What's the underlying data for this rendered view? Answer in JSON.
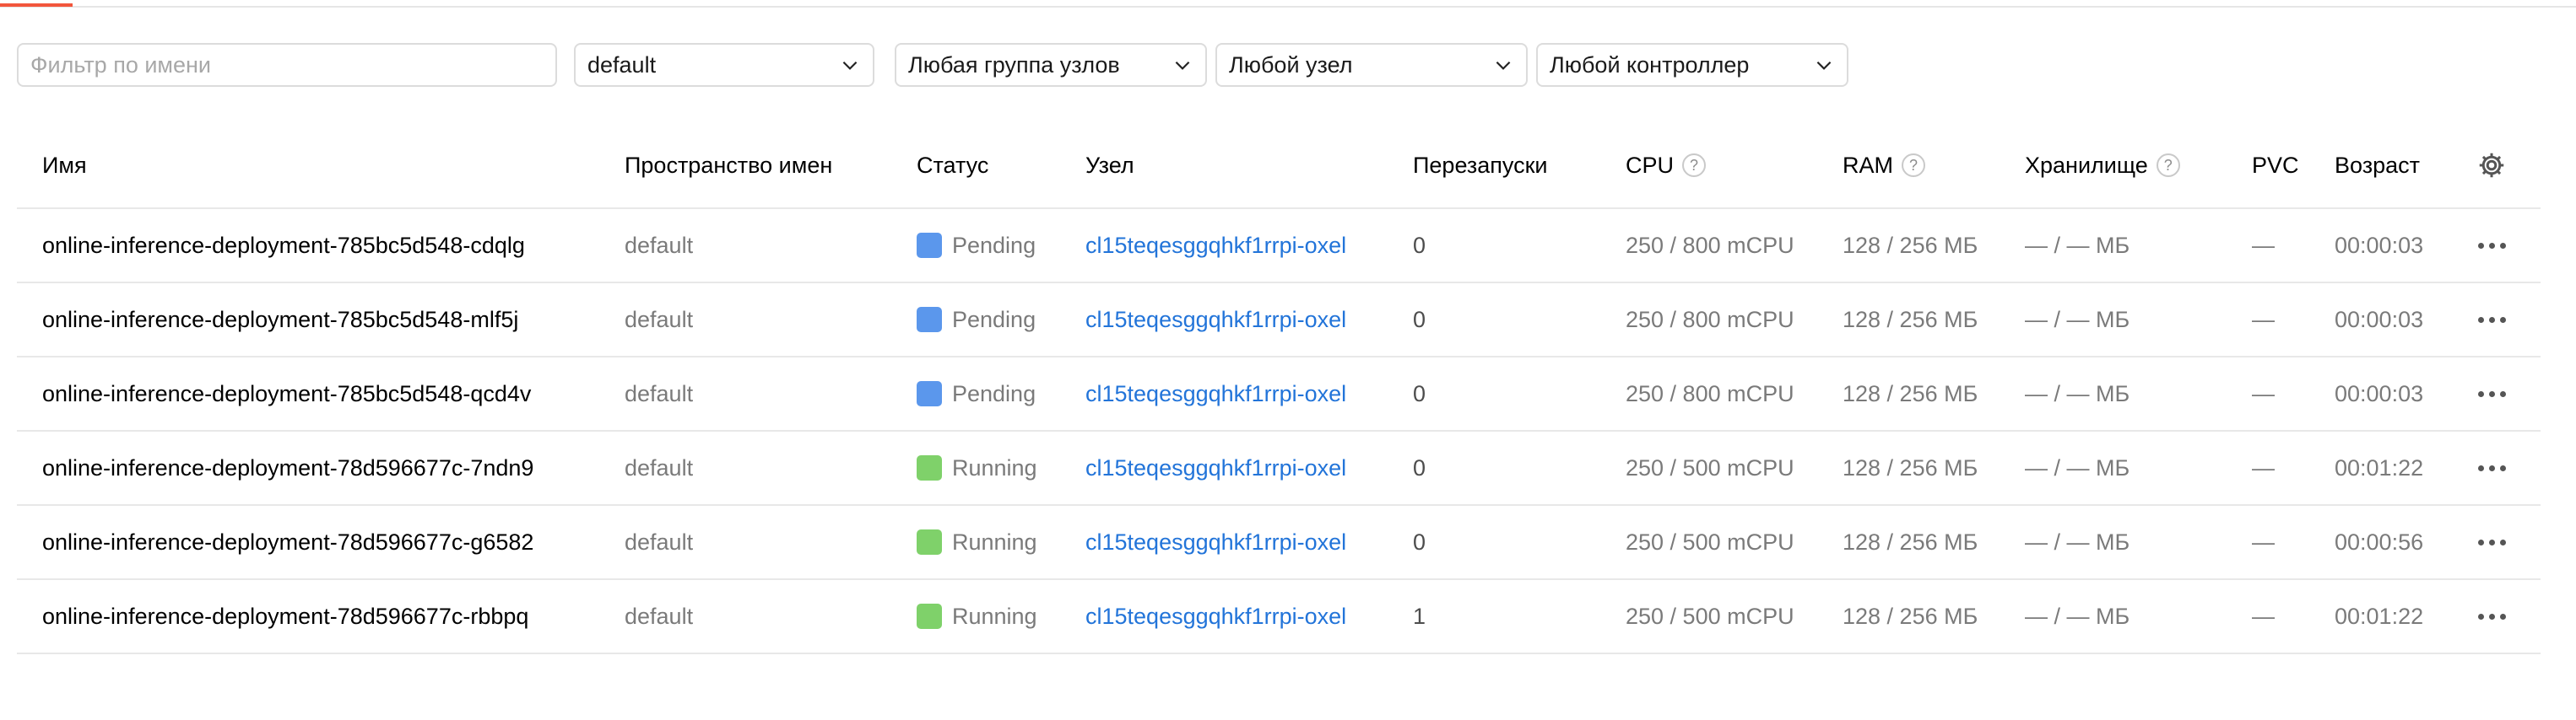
{
  "filters": {
    "name_placeholder": "Фильтр по имени",
    "namespace": "default",
    "node_group": "Любая группа узлов",
    "node": "Любой узел",
    "controller": "Любой контроллер"
  },
  "columns": {
    "name": "Имя",
    "namespace": "Пространство имен",
    "status": "Статус",
    "node": "Узел",
    "restarts": "Перезапуски",
    "cpu": "CPU",
    "ram": "RAM",
    "storage": "Хранилище",
    "pvc": "PVC",
    "age": "Возраст",
    "help_glyph": "?"
  },
  "status_colors": {
    "Pending": "#5b97ec",
    "Running": "#7fd16a"
  },
  "rows": [
    {
      "name": "online-inference-deployment-785bc5d548-cdqlg",
      "namespace": "default",
      "status": "Pending",
      "node": "cl15teqesggqhkf1rrpi-oxel",
      "restarts": "0",
      "cpu": "250 / 800 mCPU",
      "ram": "128 / 256 МБ",
      "storage": "— / — МБ",
      "pvc": "—",
      "age": "00:00:03"
    },
    {
      "name": "online-inference-deployment-785bc5d548-mlf5j",
      "namespace": "default",
      "status": "Pending",
      "node": "cl15teqesggqhkf1rrpi-oxel",
      "restarts": "0",
      "cpu": "250 / 800 mCPU",
      "ram": "128 / 256 МБ",
      "storage": "— / — МБ",
      "pvc": "—",
      "age": "00:00:03"
    },
    {
      "name": "online-inference-deployment-785bc5d548-qcd4v",
      "namespace": "default",
      "status": "Pending",
      "node": "cl15teqesggqhkf1rrpi-oxel",
      "restarts": "0",
      "cpu": "250 / 800 mCPU",
      "ram": "128 / 256 МБ",
      "storage": "— / — МБ",
      "pvc": "—",
      "age": "00:00:03"
    },
    {
      "name": "online-inference-deployment-78d596677c-7ndn9",
      "namespace": "default",
      "status": "Running",
      "node": "cl15teqesggqhkf1rrpi-oxel",
      "restarts": "0",
      "cpu": "250 / 500 mCPU",
      "ram": "128 / 256 МБ",
      "storage": "— / — МБ",
      "pvc": "—",
      "age": "00:01:22"
    },
    {
      "name": "online-inference-deployment-78d596677c-g6582",
      "namespace": "default",
      "status": "Running",
      "node": "cl15teqesggqhkf1rrpi-oxel",
      "restarts": "0",
      "cpu": "250 / 500 mCPU",
      "ram": "128 / 256 МБ",
      "storage": "— / — МБ",
      "pvc": "—",
      "age": "00:00:56"
    },
    {
      "name": "online-inference-deployment-78d596677c-rbbpq",
      "namespace": "default",
      "status": "Running",
      "node": "cl15teqesggqhkf1rrpi-oxel",
      "restarts": "1",
      "cpu": "250 / 500 mCPU",
      "ram": "128 / 256 МБ",
      "storage": "— / — МБ",
      "pvc": "—",
      "age": "00:01:22"
    }
  ]
}
